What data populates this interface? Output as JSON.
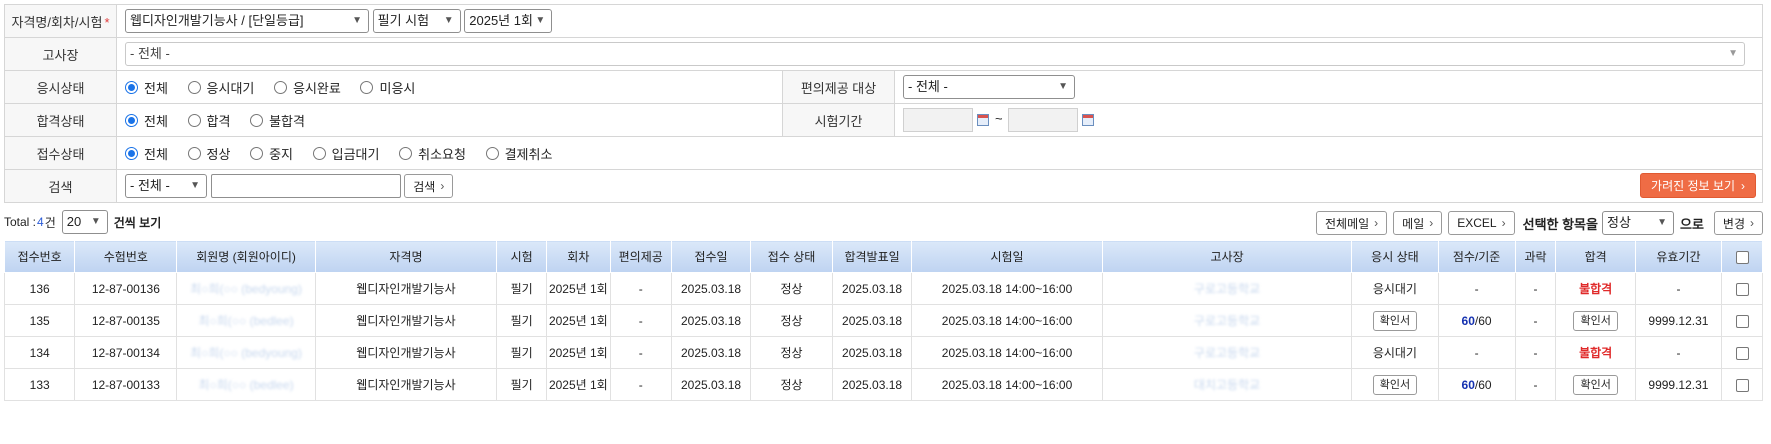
{
  "filters": {
    "cert_label": "자격명/회차/시험",
    "required_mark": "*",
    "cert_value": "웹디자인개발기능사 / [단일등급]",
    "exam_type_value": "필기 시험",
    "round_value": "2025년 1회",
    "site_label": "고사장",
    "site_value": "- 전체 -",
    "exam_status_label": "응시상태",
    "exam_status_options": [
      "전체",
      "응시대기",
      "응시완료",
      "미응시"
    ],
    "convenience_label": "편의제공 대상",
    "convenience_value": "- 전체 -",
    "pass_status_label": "합격상태",
    "pass_status_options": [
      "전체",
      "합격",
      "불합격"
    ],
    "period_label": "시험기간",
    "period_tilde": "~",
    "receipt_status_label": "접수상태",
    "receipt_status_options": [
      "전체",
      "정상",
      "중지",
      "입금대기",
      "취소요청",
      "결제취소"
    ],
    "search_label": "검색",
    "search_scope_value": "- 전체 -",
    "search_button": "검색",
    "hidden_info_button": "가려진 정보 보기"
  },
  "toolbar": {
    "total_prefix": "Total :",
    "total_count": "4",
    "total_suffix": "건",
    "page_size": "20",
    "page_size_suffix": "건씩 보기",
    "all_mail": "전체메일",
    "mail": "메일",
    "excel": "EXCEL",
    "selected_label": "선택한 항목을",
    "status_value": "정상",
    "to_label": "으로",
    "change": "변경"
  },
  "grid": {
    "columns": [
      "접수번호",
      "수험번호",
      "회원명 (회원아이디)",
      "자격명",
      "시험",
      "회차",
      "편의제공",
      "접수일",
      "접수 상태",
      "합격발표일",
      "시험일",
      "고사장",
      "응시 상태",
      "점수/기준",
      "과락",
      "합격",
      "유효기간"
    ],
    "rows": [
      {
        "no": "136",
        "exam_no": "12-87-00136",
        "member": "최○희(○○ (bedyoung)",
        "cert": "웹디자인개발기능사",
        "exam": "필기",
        "round": "2025년 1회",
        "conv": "-",
        "date": "2025.03.18",
        "status": "정상",
        "announce": "2025.03.18",
        "exam_date": "2025.03.18 14:00~16:00",
        "site": "구로고등학교",
        "exam_state": "응시대기",
        "exam_state_btn": false,
        "score_main": "",
        "score_rest": "-",
        "fail_cut": "-",
        "result": "불합격",
        "result_btn": false,
        "valid": "-"
      },
      {
        "no": "135",
        "exam_no": "12-87-00135",
        "member": "최○희(○○ (bedlee)",
        "cert": "웹디자인개발기능사",
        "exam": "필기",
        "round": "2025년 1회",
        "conv": "-",
        "date": "2025.03.18",
        "status": "정상",
        "announce": "2025.03.18",
        "exam_date": "2025.03.18 14:00~16:00",
        "site": "구로고등학교",
        "exam_state": "확인서",
        "exam_state_btn": true,
        "score_main": "60",
        "score_rest": "/60",
        "fail_cut": "-",
        "result": "확인서",
        "result_btn": true,
        "valid": "9999.12.31"
      },
      {
        "no": "134",
        "exam_no": "12-87-00134",
        "member": "최○희(○○ (bedyoung)",
        "cert": "웹디자인개발기능사",
        "exam": "필기",
        "round": "2025년 1회",
        "conv": "-",
        "date": "2025.03.18",
        "status": "정상",
        "announce": "2025.03.18",
        "exam_date": "2025.03.18 14:00~16:00",
        "site": "구로고등학교",
        "exam_state": "응시대기",
        "exam_state_btn": false,
        "score_main": "",
        "score_rest": "-",
        "fail_cut": "-",
        "result": "불합격",
        "result_btn": false,
        "valid": "-"
      },
      {
        "no": "133",
        "exam_no": "12-87-00133",
        "member": "최○희(○○ (bedlee)",
        "cert": "웹디자인개발기능사",
        "exam": "필기",
        "round": "2025년 1회",
        "conv": "-",
        "date": "2025.03.18",
        "status": "정상",
        "announce": "2025.03.18",
        "exam_date": "2025.03.18 14:00~16:00",
        "site": "대치고등학교",
        "exam_state": "확인서",
        "exam_state_btn": true,
        "score_main": "60",
        "score_rest": "/60",
        "fail_cut": "-",
        "result": "확인서",
        "result_btn": true,
        "valid": "9999.12.31"
      }
    ]
  },
  "colors": {
    "accent": "#1a73e8",
    "fail": "#e02a2a",
    "score": "#1531b0",
    "orange_button": "#ef6c45",
    "header_bg": "#c9dcf5"
  }
}
